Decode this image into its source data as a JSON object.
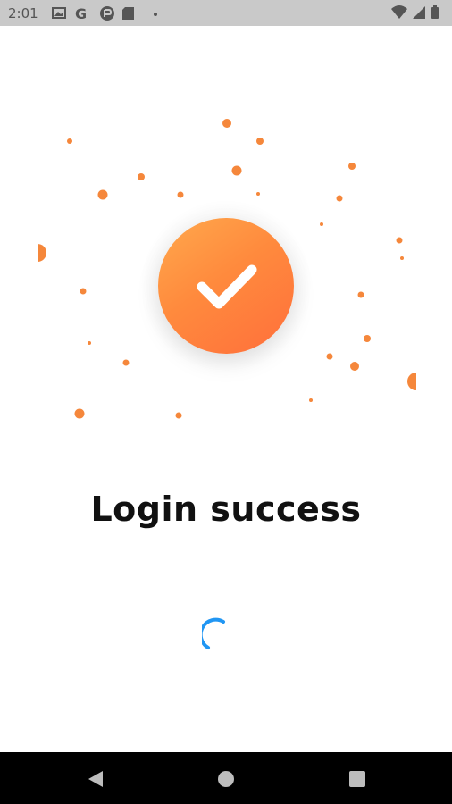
{
  "status_bar": {
    "time": "2:01",
    "left_icons": [
      "photo-notification-icon",
      "google-icon",
      "app-notification-icon",
      "sd-card-icon",
      "dot-icon"
    ],
    "right_icons": [
      "wifi-icon",
      "cellular-signal-icon",
      "battery-icon"
    ]
  },
  "success": {
    "title": "Login success",
    "badge_icon": "checkmark-icon",
    "accent_color": "#ff8a3d"
  },
  "loading": {
    "icon": "loading-spinner-icon",
    "color": "#2196f3"
  },
  "navigation": {
    "buttons": [
      "back-icon",
      "home-icon",
      "recents-icon"
    ]
  }
}
